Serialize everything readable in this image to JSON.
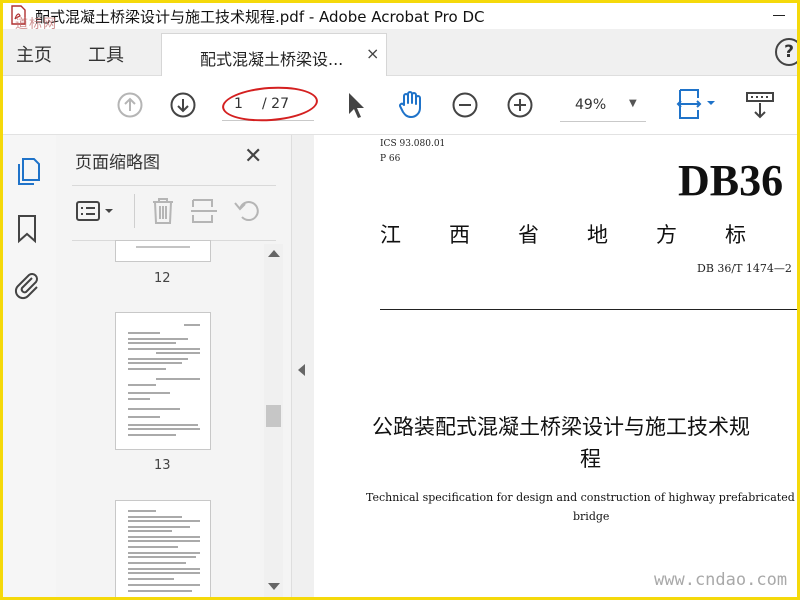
{
  "window": {
    "title": "配式混凝土桥梁设计与施工技术规程.pdf - Adobe Acrobat Pro DC"
  },
  "watermarks": {
    "top_left": "道标网",
    "bottom_right": "www.cndao.com"
  },
  "nav": {
    "home_label": "主页",
    "tools_label": "工具"
  },
  "tab": {
    "label": "配式混凝土桥梁设...",
    "close_glyph": "×"
  },
  "toolbar": {
    "current_page": "1",
    "total_pages": "/ 27",
    "zoom": "49%"
  },
  "thumbnails_panel": {
    "title": "页面缩略图",
    "close_glyph": "✕",
    "pages": [
      {
        "label": "12"
      },
      {
        "label": "13"
      }
    ]
  },
  "document": {
    "ics": "ICS 93.080.01",
    "classification": "P 66",
    "standard_code": "DB36",
    "standard_type_chars": [
      "江",
      "西",
      "省",
      "地",
      "方",
      "标"
    ],
    "standard_number": "DB 36/T 1474—2",
    "title_line1": "公路装配式混凝土桥梁设计与施工技术规",
    "title_line2": "程",
    "english_line1": "Technical specification for design and construction of highway prefabricated conc",
    "english_line2": "bridge"
  },
  "colors": {
    "accent_blue": "#1f73c9",
    "annotation_red": "#d42020",
    "frame_yellow": "#f5d90a"
  }
}
